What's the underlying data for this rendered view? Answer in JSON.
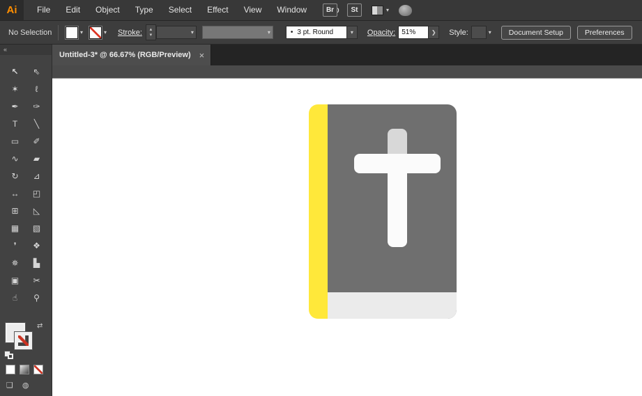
{
  "app": {
    "logo": "Ai",
    "menus": [
      "File",
      "Edit",
      "Object",
      "Type",
      "Select",
      "Effect",
      "View",
      "Window",
      "Help"
    ],
    "bridge_button": "Br",
    "stock_button": "St"
  },
  "icons": {
    "chevron_down": "▾",
    "chevron_right": "❯",
    "stepper_up": "▴",
    "stepper_down": "▾",
    "close": "×",
    "collapse": "«",
    "swap": "⇄",
    "bullet": "•",
    "draw_modes": "❑",
    "screen_mode": "◍"
  },
  "control_bar": {
    "selection_status": "No Selection",
    "stroke_label": "Stroke:",
    "brush_value": "3 pt. Round",
    "opacity_label": "Opacity:",
    "opacity_value": "51%",
    "style_label": "Style:",
    "document_setup_button": "Document Setup",
    "preferences_button": "Preferences"
  },
  "document_tab": {
    "title": "Untitled-3* @ 66.67% (RGB/Preview)"
  },
  "toolbar": {
    "tools": [
      {
        "name": "selection-tool",
        "glyph": "↖"
      },
      {
        "name": "direct-selection-tool",
        "glyph": "⇖"
      },
      {
        "name": "magic-wand-tool",
        "glyph": "✶"
      },
      {
        "name": "lasso-tool",
        "glyph": "ℓ"
      },
      {
        "name": "pen-tool",
        "glyph": "✒"
      },
      {
        "name": "curvature-tool",
        "glyph": "✑"
      },
      {
        "name": "type-tool",
        "glyph": "T"
      },
      {
        "name": "line-segment-tool",
        "glyph": "╲"
      },
      {
        "name": "rectangle-tool",
        "glyph": "▭"
      },
      {
        "name": "paintbrush-tool",
        "glyph": "✐"
      },
      {
        "name": "shaper-tool",
        "glyph": "∿"
      },
      {
        "name": "eraser-tool",
        "glyph": "▰"
      },
      {
        "name": "rotate-tool",
        "glyph": "↻"
      },
      {
        "name": "scale-tool",
        "glyph": "⊿"
      },
      {
        "name": "width-tool",
        "glyph": "↔"
      },
      {
        "name": "free-transform-tool",
        "glyph": "◰"
      },
      {
        "name": "shape-builder-tool",
        "glyph": "⊞"
      },
      {
        "name": "perspective-grid-tool",
        "glyph": "◺"
      },
      {
        "name": "mesh-tool",
        "glyph": "▦"
      },
      {
        "name": "gradient-tool",
        "glyph": "▧"
      },
      {
        "name": "eyedropper-tool",
        "glyph": "❜"
      },
      {
        "name": "blend-tool",
        "glyph": "❖"
      },
      {
        "name": "symbol-sprayer-tool",
        "glyph": "✵"
      },
      {
        "name": "column-graph-tool",
        "glyph": "▙"
      },
      {
        "name": "artboard-tool",
        "glyph": "▣"
      },
      {
        "name": "slice-tool",
        "glyph": "✂"
      },
      {
        "name": "hand-tool",
        "glyph": "☝"
      },
      {
        "name": "zoom-tool",
        "glyph": "⚲"
      }
    ]
  },
  "canvas": {
    "artwork": "bible-book-icon",
    "colors": {
      "spine": "#FFE83A",
      "cover": "#6F6F6F",
      "pages": "#EBEBEB",
      "cross": "#FBFBFB",
      "cross_shadow": "#D8D8D8"
    }
  }
}
